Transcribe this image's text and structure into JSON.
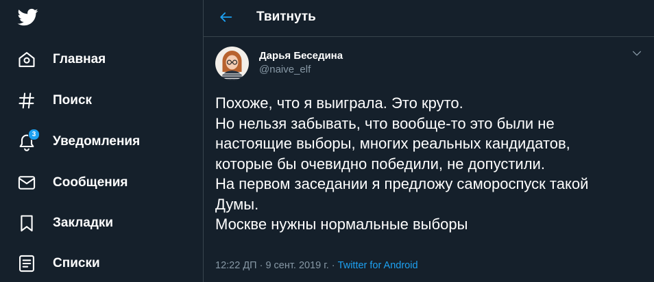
{
  "colors": {
    "background": "#15202b",
    "accent": "#1da1f2",
    "text_primary": "#ffffff",
    "text_secondary": "#8899a6",
    "border": "#38444d"
  },
  "sidebar": {
    "logo_icon": "twitter-bird-icon",
    "items": [
      {
        "label": "Главная",
        "icon": "home-icon"
      },
      {
        "label": "Поиск",
        "icon": "hashtag-icon"
      },
      {
        "label": "Уведомления",
        "icon": "bell-icon",
        "badge": "3"
      },
      {
        "label": "Сообщения",
        "icon": "envelope-icon"
      },
      {
        "label": "Закладки",
        "icon": "bookmark-icon"
      },
      {
        "label": "Списки",
        "icon": "list-icon"
      }
    ]
  },
  "header": {
    "back_icon": "arrow-left-icon",
    "title": "Твитнуть"
  },
  "tweet": {
    "author_name": "Дарья Беседина",
    "author_handle": "@naive_elf",
    "menu_icon": "chevron-down-icon",
    "lines": [
      "Похоже, что я выиграла. Это круто.",
      "Но нельзя забывать, что вообще-то это были не",
      "настоящие выборы, многих реальных кандидатов,",
      "которые бы очевидно победили, не допустили.",
      "На первом заседании я предложу самороспуск такой",
      "Думы.",
      "Москве нужны нормальные выборы"
    ],
    "timestamp": "12:22 ДП · 9 сент. 2019 г. · ",
    "source": "Twitter for Android"
  }
}
